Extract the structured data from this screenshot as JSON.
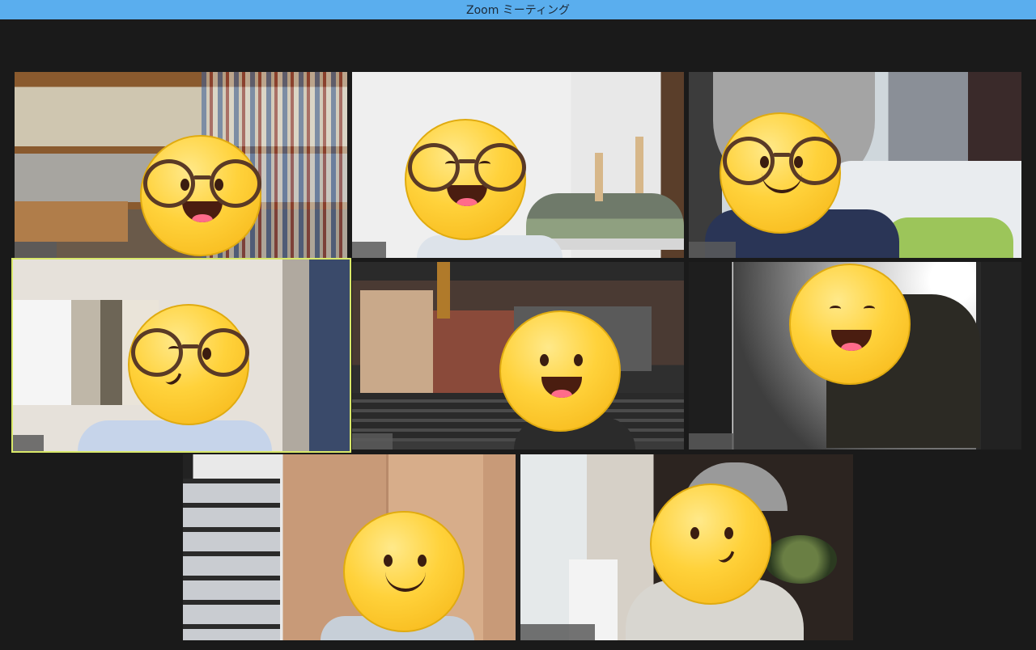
{
  "window": {
    "title": "Zoom ミーティング"
  },
  "participants": [
    {
      "tile": "tile-1",
      "name_label": "",
      "face": "glasses-open-mouth",
      "active": false
    },
    {
      "tile": "tile-2",
      "name_label": "",
      "face": "glasses-laughing",
      "active": false
    },
    {
      "tile": "tile-3",
      "name_label": "",
      "face": "glasses-smile",
      "active": false
    },
    {
      "tile": "tile-4",
      "name_label": "",
      "face": "glasses-wink",
      "active": true
    },
    {
      "tile": "tile-5",
      "name_label": "",
      "face": "grin",
      "active": false
    },
    {
      "tile": "tile-6",
      "name_label": "",
      "face": "laughing",
      "active": false
    },
    {
      "tile": "tile-7",
      "name_label": "",
      "face": "smile",
      "active": false
    },
    {
      "tile": "tile-8",
      "name_label": "",
      "face": "smirk",
      "active": false
    }
  ],
  "colors": {
    "titlebar": "#5aaeee",
    "active_speaker_border": "#d9e86a",
    "background": "#1a1a1a"
  }
}
